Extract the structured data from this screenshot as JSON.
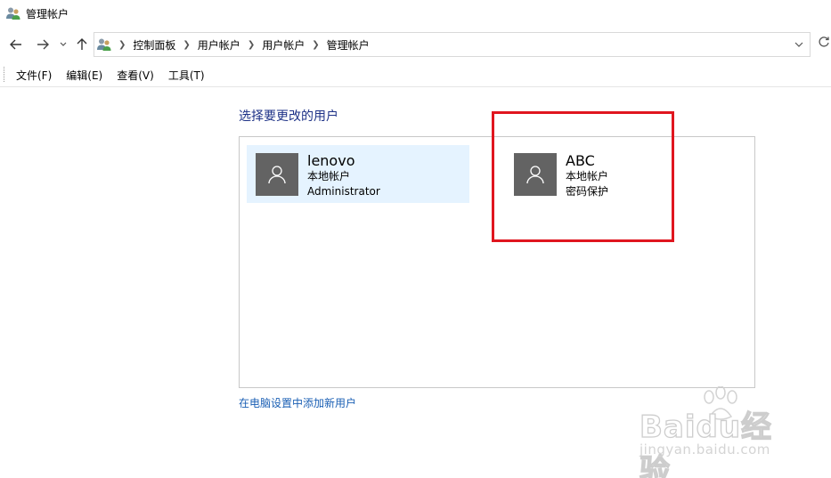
{
  "window": {
    "title": "管理帐户"
  },
  "navigation": {
    "back_icon": "arrow-left-icon",
    "forward_icon": "arrow-right-icon",
    "recent_icon": "chevron-down-icon",
    "up_icon": "arrow-up-icon",
    "breadcrumbs": [
      "控制面板",
      "用户帐户",
      "用户帐户",
      "管理帐户"
    ],
    "refresh_icon": "refresh-icon"
  },
  "menu": {
    "items": [
      "文件(F)",
      "编辑(E)",
      "查看(V)",
      "工具(T)"
    ]
  },
  "main": {
    "heading": "选择要更改的用户",
    "users": [
      {
        "name": "lenovo",
        "type": "本地帐户",
        "detail": "Administrator",
        "selected": true
      },
      {
        "name": "ABC",
        "type": "本地帐户",
        "detail": "密码保护",
        "selected": false
      }
    ],
    "add_user_link": "在电脑设置中添加新用户"
  },
  "colors": {
    "heading": "#1e3287",
    "link": "#1a5fb4",
    "avatar_bg": "#636363",
    "selected_tile": "#e5f3ff",
    "highlight_box": "#e0161f"
  },
  "watermark": {
    "brand": "Baidu经验",
    "site": "jingyan.baidu.com"
  }
}
